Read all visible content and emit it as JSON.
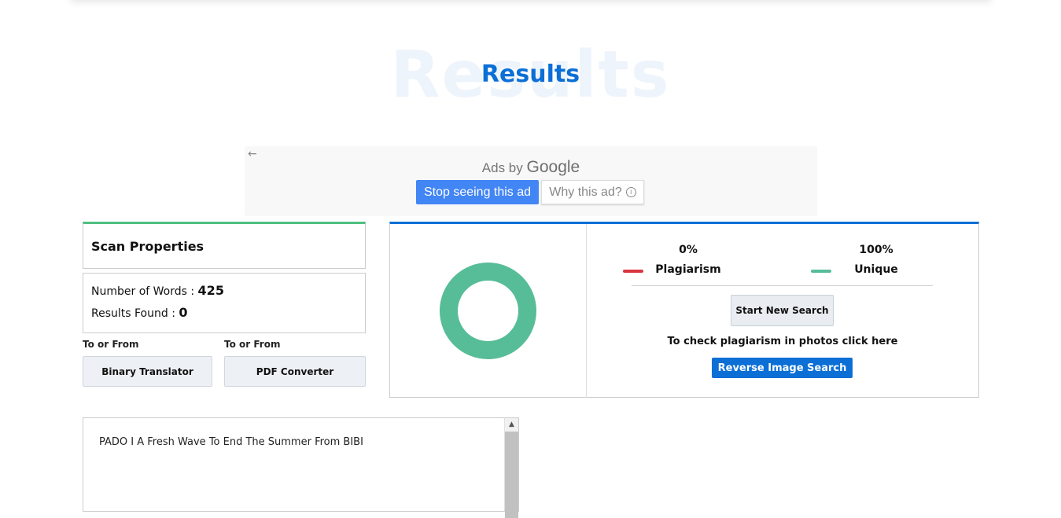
{
  "header": {
    "watermark": "Results",
    "title": "Results"
  },
  "ad": {
    "ads_by": "Ads by",
    "google": "Google",
    "stop_label": "Stop seeing this ad",
    "why_label": "Why this ad?",
    "back_icon": "arrow-left-icon",
    "info_icon": "info-icon"
  },
  "scan": {
    "title": "Scan Properties",
    "words_label": "Number of Words :",
    "words_value": "425",
    "results_label": "Results Found :",
    "results_value": "0"
  },
  "tools": {
    "to_from_1": "To or From",
    "to_from_2": "To or From",
    "binary_label": "Binary Translator",
    "pdf_label": "PDF Converter"
  },
  "result": {
    "plagiarism_pct": "0%",
    "plagiarism_label": "Plagiarism",
    "unique_pct": "100%",
    "unique_label": "Unique",
    "start_label": "Start New Search",
    "photo_note": "To check plagiarism in photos click here",
    "reverse_label": "Reverse Image Search",
    "plagiarism_fraction": 0,
    "unique_fraction": 1,
    "colors": {
      "plagiarism": "#d9343f",
      "unique": "#57bd98"
    }
  },
  "text_area": {
    "content": "PADO I A Fresh Wave To End The Summer From BIBI"
  },
  "theme": {
    "accent_blue": "#0b6fd6",
    "accent_green": "#4fc07f"
  }
}
